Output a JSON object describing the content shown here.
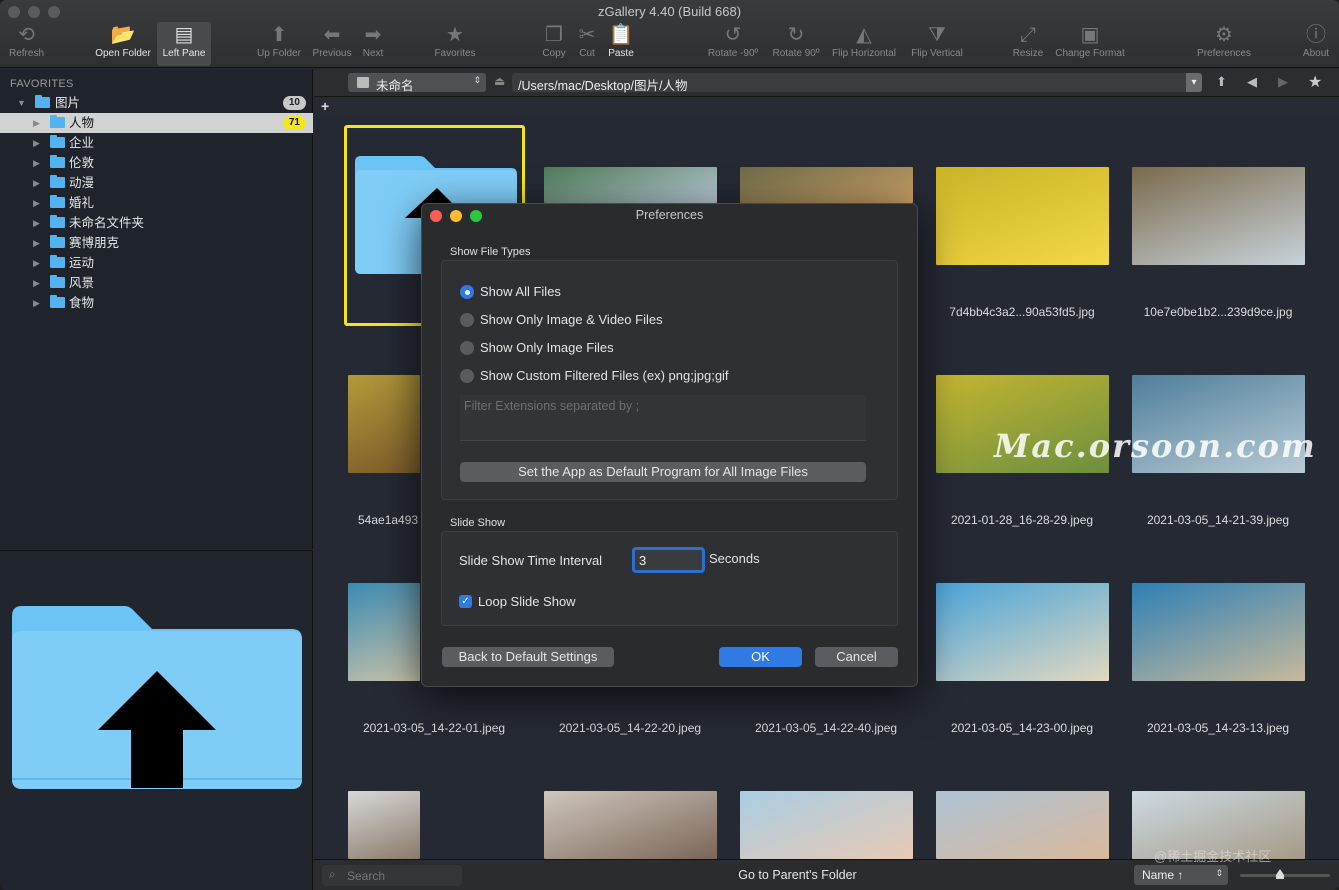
{
  "window": {
    "title": "zGallery 4.40 (Build 668)"
  },
  "toolbar": [
    {
      "label": "Refresh",
      "icon": "refresh-icon",
      "glyph": "⟲",
      "enabled": false
    },
    {
      "label": "Open Folder",
      "icon": "open-folder-icon",
      "glyph": "📂",
      "enabled": true
    },
    {
      "label": "Left Pane",
      "icon": "left-pane-icon",
      "glyph": "▤",
      "enabled": true,
      "selected": true
    },
    {
      "label": "Up Folder",
      "icon": "up-arrow-icon",
      "glyph": "⬆",
      "enabled": false
    },
    {
      "label": "Previous",
      "icon": "left-arrow-icon",
      "glyph": "⬅",
      "enabled": false
    },
    {
      "label": "Next",
      "icon": "right-arrow-icon",
      "glyph": "➡",
      "enabled": false
    },
    {
      "label": "Favorites",
      "icon": "star-icon",
      "glyph": "★",
      "enabled": false
    },
    {
      "label": "Copy",
      "icon": "copy-icon",
      "glyph": "❐",
      "enabled": false
    },
    {
      "label": "Cut",
      "icon": "scissors-icon",
      "glyph": "✂",
      "enabled": false
    },
    {
      "label": "Paste",
      "icon": "paste-icon",
      "glyph": "📋",
      "enabled": true
    },
    {
      "label": "Rotate -90º",
      "icon": "rotate-left-icon",
      "glyph": "↺",
      "enabled": false
    },
    {
      "label": "Rotate 90º",
      "icon": "rotate-right-icon",
      "glyph": "↻",
      "enabled": false
    },
    {
      "label": "Flip Horizontal",
      "icon": "flip-horizontal-icon",
      "glyph": "◭",
      "enabled": false
    },
    {
      "label": "Flip Vertical",
      "icon": "flip-vertical-icon",
      "glyph": "⧩",
      "enabled": false
    },
    {
      "label": "Resize",
      "icon": "resize-icon",
      "glyph": "⤢",
      "enabled": false
    },
    {
      "label": "Change Format",
      "icon": "change-format-icon",
      "glyph": "▣",
      "enabled": false
    },
    {
      "label": "Preferences",
      "icon": "gear-icon",
      "glyph": "⚙",
      "enabled": false
    },
    {
      "label": "About",
      "icon": "info-icon",
      "glyph": "ⓘ",
      "enabled": false
    }
  ],
  "sidebar": {
    "heading": "FAVORITES",
    "root": {
      "label": "图片",
      "badge": "10"
    },
    "items": [
      {
        "label": "人物",
        "badge": "71",
        "selected": true
      },
      {
        "label": "企业"
      },
      {
        "label": "伦敦"
      },
      {
        "label": "动漫"
      },
      {
        "label": "婚礼"
      },
      {
        "label": "未命名文件夹"
      },
      {
        "label": "赛博朋克"
      },
      {
        "label": "运动"
      },
      {
        "label": "风景"
      },
      {
        "label": "食物"
      }
    ]
  },
  "pathbar": {
    "volume": "未命名",
    "path": "/Users/mac/Desktop/图片/人物"
  },
  "grid": {
    "captions": [
      "",
      "",
      "",
      "7d4bb4c3a2...90a53fd5.jpg",
      "10e7e0be1b2...239d9ce.jpg",
      "54ae1a493",
      "",
      "",
      "2021-01-28_16-28-29.jpeg",
      "2021-03-05_14-21-39.jpeg",
      "2021-03-05_14-22-01.jpeg",
      "2021-03-05_14-22-20.jpeg",
      "2021-03-05_14-22-40.jpeg",
      "2021-03-05_14-23-00.jpeg",
      "2021-03-05_14-23-13.jpeg"
    ],
    "watermark": "Mac.orsoon.com"
  },
  "status": {
    "search_placeholder": "Search",
    "center": "Go to Parent's Folder",
    "sort": "Name ↑",
    "corner_watermark": "@稀土掘金技术社区"
  },
  "dialog": {
    "title": "Preferences",
    "file_types_heading": "Show File Types",
    "options": [
      {
        "label": "Show All Files",
        "selected": true
      },
      {
        "label": "Show Only Image & Video Files",
        "selected": false
      },
      {
        "label": "Show Only Image Files",
        "selected": false
      },
      {
        "label": "Show Custom Filtered Files (ex) png;jpg;gif",
        "selected": false
      }
    ],
    "filter_placeholder": "Filter Extensions separated by ;",
    "default_program_button": "Set the App as Default Program for All Image Files",
    "slideshow_heading": "Slide Show",
    "interval_label": "Slide Show Time Interval",
    "interval_value": "3",
    "interval_unit": "Seconds",
    "loop_label": "Loop Slide Show",
    "loop_checked": true,
    "reset_button": "Back to Default Settings",
    "ok_button": "OK",
    "cancel_button": "Cancel"
  }
}
